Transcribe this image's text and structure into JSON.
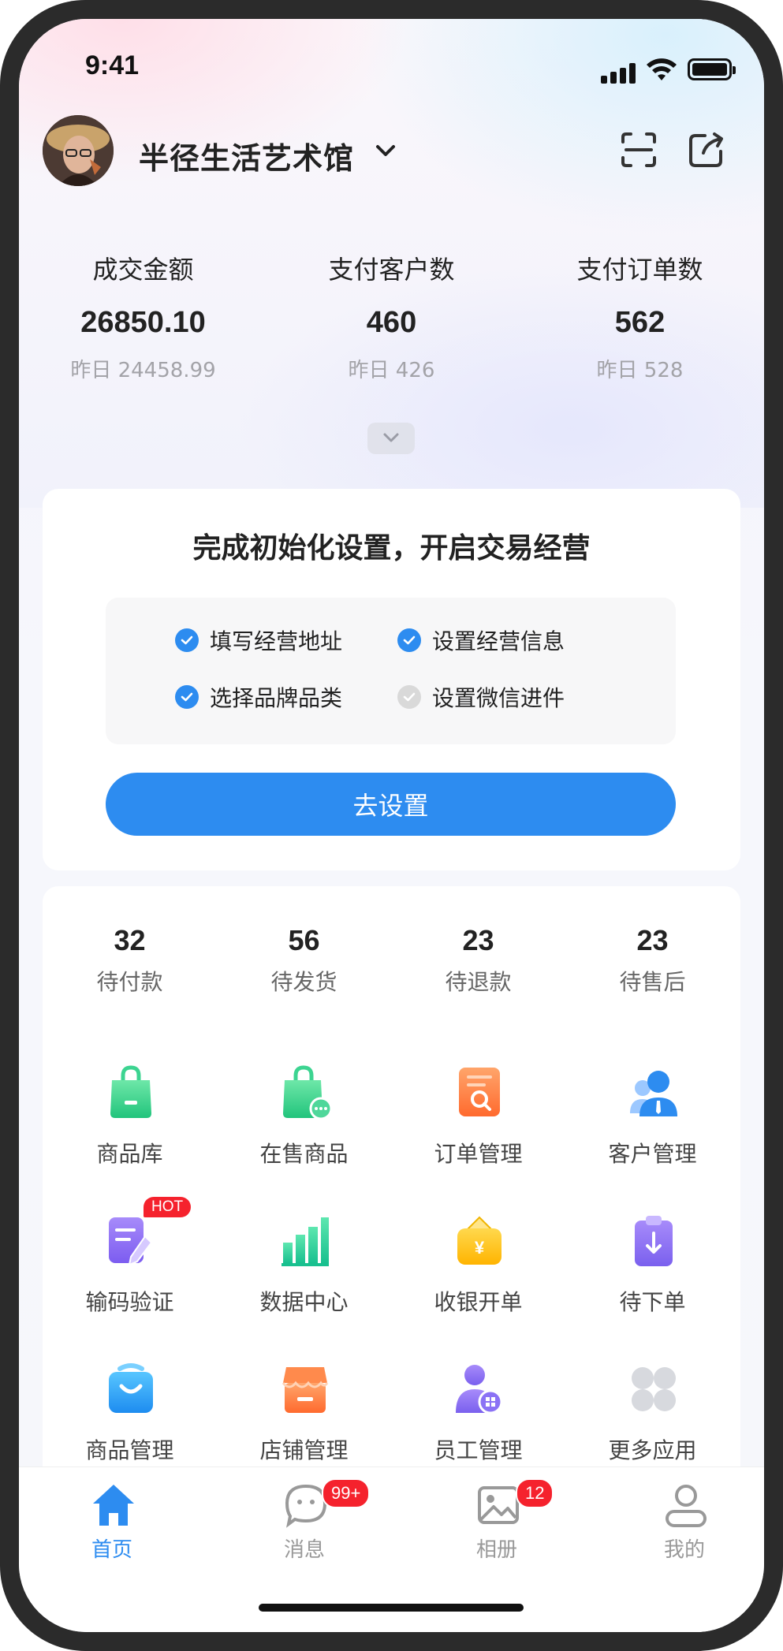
{
  "status_bar": {
    "time": "9:41"
  },
  "header": {
    "store_name": "半径生活艺术馆",
    "icons": [
      "scan-icon",
      "share-icon"
    ]
  },
  "stats": [
    {
      "label": "成交金额",
      "value": "26850.10",
      "prev": "昨日 24458.99"
    },
    {
      "label": "支付客户数",
      "value": "460",
      "prev": "昨日 426"
    },
    {
      "label": "支付订单数",
      "value": "562",
      "prev": "昨日 528"
    }
  ],
  "setup": {
    "title": "完成初始化设置，开启交易经营",
    "items": [
      {
        "label": "填写经营地址",
        "done": true
      },
      {
        "label": "设置经营信息",
        "done": true
      },
      {
        "label": "选择品牌品类",
        "done": true
      },
      {
        "label": "设置微信进件",
        "done": false
      }
    ],
    "button": "去设置"
  },
  "order_counts": [
    {
      "num": "32",
      "label": "待付款"
    },
    {
      "num": "56",
      "label": "待发货"
    },
    {
      "num": "23",
      "label": "待退款"
    },
    {
      "num": "23",
      "label": "待售后"
    }
  ],
  "apps": [
    {
      "label": "商品库",
      "icon": "shopping-bag-icon"
    },
    {
      "label": "在售商品",
      "icon": "bag-chat-icon"
    },
    {
      "label": "订单管理",
      "icon": "order-search-icon"
    },
    {
      "label": "客户管理",
      "icon": "customer-icon"
    },
    {
      "label": "输码验证",
      "icon": "code-verify-icon",
      "tag": "HOT"
    },
    {
      "label": "数据中心",
      "icon": "bar-chart-icon"
    },
    {
      "label": "收银开单",
      "icon": "cashier-icon"
    },
    {
      "label": "待下单",
      "icon": "clipboard-download-icon"
    },
    {
      "label": "商品管理",
      "icon": "basket-icon"
    },
    {
      "label": "店铺管理",
      "icon": "storefront-icon"
    },
    {
      "label": "员工管理",
      "icon": "staff-icon"
    },
    {
      "label": "更多应用",
      "icon": "more-apps-icon"
    }
  ],
  "tabbar": [
    {
      "label": "首页",
      "icon": "home-icon",
      "active": true
    },
    {
      "label": "消息",
      "icon": "chat-icon",
      "badge": "99+"
    },
    {
      "label": "相册",
      "icon": "gallery-icon",
      "badge": "12"
    },
    {
      "label": "我的",
      "icon": "user-icon"
    }
  ],
  "colors": {
    "accent": "#2d8cf0",
    "badge": "#f5222d",
    "check_done": "#2d8cf0",
    "check_todo": "#d9d9d9"
  }
}
